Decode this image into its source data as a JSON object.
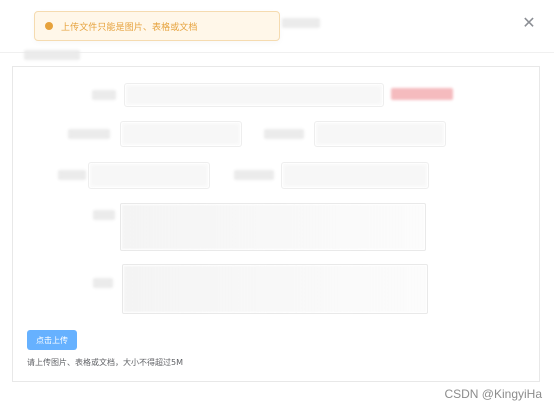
{
  "toast": {
    "message": "上传文件只能是图片、表格或文档",
    "icon": "warning-icon"
  },
  "dialog": {
    "close_icon": "close-icon"
  },
  "upload": {
    "button_label": "点击上传",
    "tip": "请上传图片、表格或文档，大小不得超过5M"
  },
  "watermark": {
    "text": "CSDN @KingyiHa"
  },
  "colors": {
    "warning": "#e6a23c",
    "toast_bg": "#fff7e9",
    "toast_border": "#f5dbb0",
    "primary": "#66b1ff",
    "text": "#606266",
    "border": "#e8e8e8"
  }
}
